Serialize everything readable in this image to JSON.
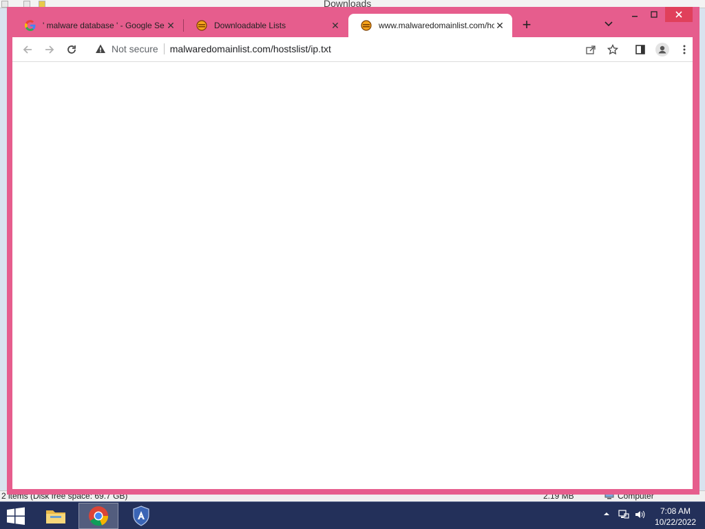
{
  "background_window": {
    "title": "Downloads",
    "status_items": "2 items (Disk free space: 69.7 GB)",
    "status_size": "2.19 MB",
    "status_location": "Computer"
  },
  "browser": {
    "tabs": [
      {
        "title": "' malware database ' - Google Se",
        "favicon": "google-icon",
        "active": false
      },
      {
        "title": "Downloadable Lists",
        "favicon": "malwaredomainlist-icon",
        "active": false
      },
      {
        "title": "www.malwaredomainlist.com/hc",
        "favicon": "malwaredomainlist-icon",
        "active": true
      }
    ],
    "new_tab_label": "+",
    "close_glyph": "✕",
    "address_bar": {
      "security_label": "Not secure",
      "url": "malwaredomainlist.com/hostslist/ip.txt"
    }
  },
  "taskbar": {
    "apps": [
      "file-explorer",
      "google-chrome",
      "security-shield"
    ],
    "clock_time": "7:08 AM",
    "clock_date": "10/22/2022"
  },
  "colors": {
    "chrome_frame": "#e65d8d",
    "taskbar": "#23305a",
    "close_button": "#e0405b"
  }
}
